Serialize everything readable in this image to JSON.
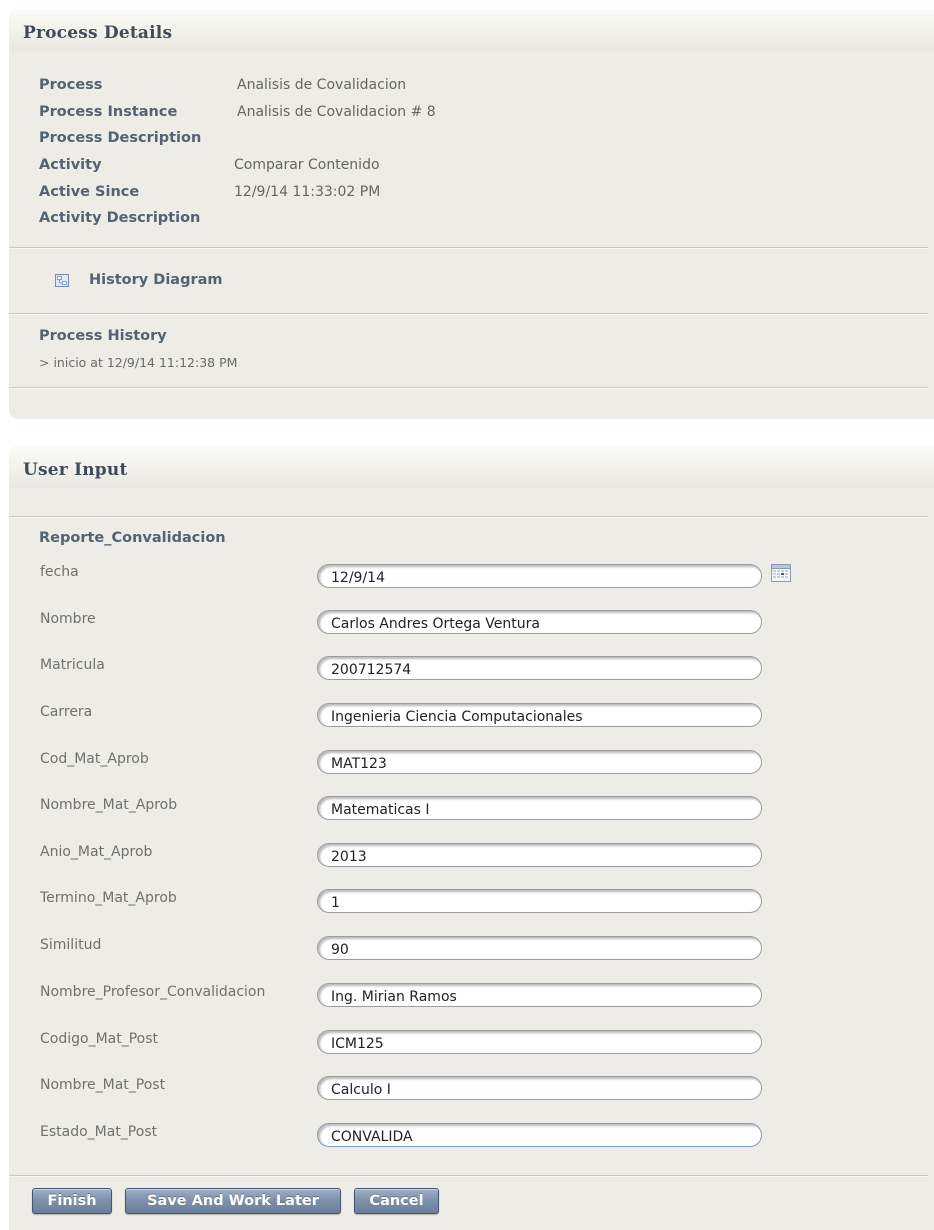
{
  "process_details": {
    "title": "Process Details",
    "rows": [
      {
        "label": "Process",
        "value": "Analisis de Covalidacion"
      },
      {
        "label": "Process Instance",
        "value": "Analisis de Covalidacion # 8"
      },
      {
        "label": "Process Description",
        "value": ""
      },
      {
        "label": "Activity",
        "value": "Comparar Contenido"
      },
      {
        "label": "Active Since",
        "value": "12/9/14 11:33:02 PM"
      },
      {
        "label": "Activity Description",
        "value": ""
      }
    ],
    "history_diagram_label": "History Diagram",
    "history_title": "Process History",
    "history_entries": [
      "> inicio at 12/9/14 11:12:38 PM"
    ]
  },
  "user_input": {
    "title": "User Input",
    "form_title": "Reporte_Convalidacion",
    "fields": [
      {
        "label": "fecha",
        "value": "12/9/14"
      },
      {
        "label": "Nombre",
        "value": "Carlos Andres Ortega Ventura"
      },
      {
        "label": "Matricula",
        "value": "200712574"
      },
      {
        "label": "Carrera",
        "value": "Ingenieria Ciencia Computacionales"
      },
      {
        "label": "Cod_Mat_Aprob",
        "value": "MAT123"
      },
      {
        "label": "Nombre_Mat_Aprob",
        "value": "Matematicas I"
      },
      {
        "label": "Anio_Mat_Aprob",
        "value": "2013"
      },
      {
        "label": "Termino_Mat_Aprob",
        "value": "1"
      },
      {
        "label": "Similitud",
        "value": "90"
      },
      {
        "label": "Nombre_Profesor_Convalidacion",
        "value": "Ing. Mirian Ramos"
      },
      {
        "label": "Codigo_Mat_Post",
        "value": "ICM125"
      },
      {
        "label": "Nombre_Mat_Post",
        "value": "Calculo I"
      },
      {
        "label": "Estado_Mat_Post",
        "value": "CONVALIDA"
      }
    ]
  },
  "buttons": {
    "finish": "Finish",
    "save_and_work_later": "Save And Work Later",
    "cancel": "Cancel"
  },
  "icons": {
    "history_diagram": "diagram-icon",
    "date_picker": "calendar-icon"
  },
  "colors": {
    "panel_bg": "#edece6",
    "heading": "#3f4a5a",
    "label_bold": "#556273",
    "button": "#7f92ad"
  }
}
